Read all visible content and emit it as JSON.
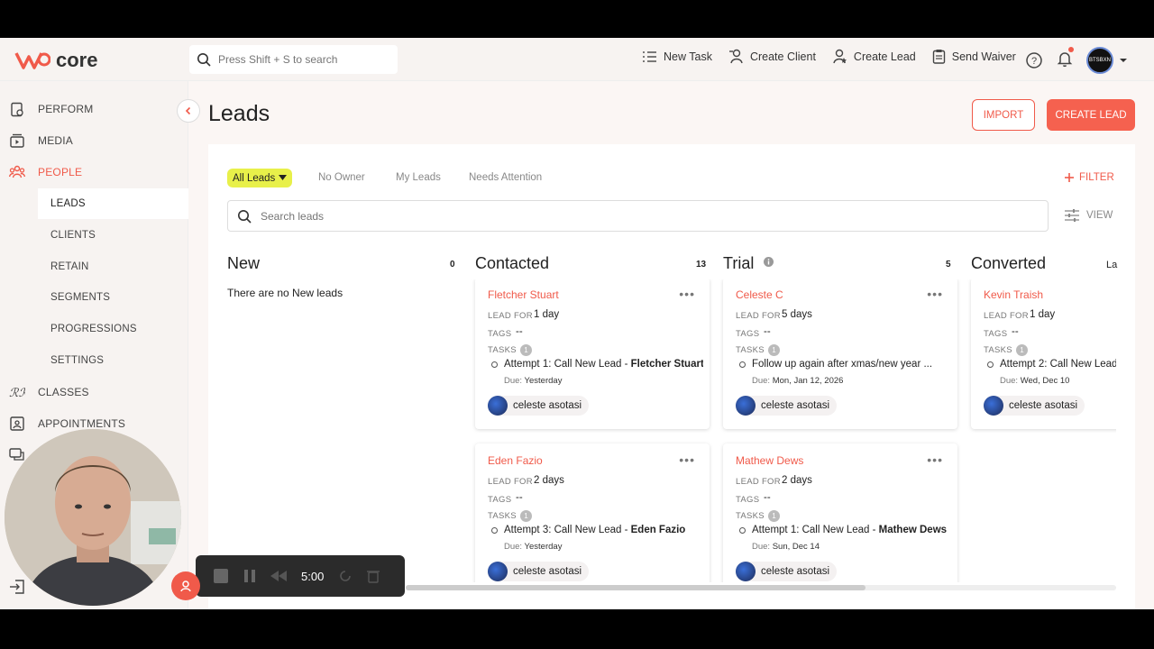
{
  "app": {
    "logo_text": "core"
  },
  "header": {
    "search_placeholder": "Press Shift + S to search",
    "actions": [
      {
        "label": "New Task",
        "icon": "tasks-icon"
      },
      {
        "label": "Create Client",
        "icon": "add-client-icon"
      },
      {
        "label": "Create Lead",
        "icon": "add-lead-icon"
      },
      {
        "label": "Send Waiver",
        "icon": "clipboard-icon"
      }
    ],
    "avatar_text": "BTSBXN"
  },
  "sidebar": {
    "items": [
      {
        "label": "PERFORM",
        "icon": "clipboard-check-icon"
      },
      {
        "label": "MEDIA",
        "icon": "media-icon"
      },
      {
        "label": "PEOPLE",
        "icon": "people-icon"
      },
      {
        "label": "CLASSES",
        "icon": "classes-icon"
      },
      {
        "label": "APPOINTMENTS",
        "icon": "appointments-icon"
      }
    ],
    "sub_items": [
      "LEADS",
      "CLIENTS",
      "RETAIN",
      "SEGMENTS",
      "PROGRESSIONS",
      "SETTINGS"
    ],
    "active_sub": "LEADS"
  },
  "main": {
    "title": "Leads",
    "import_label": "IMPORT",
    "create_label": "CREATE LEAD",
    "filters": {
      "active": "All Leads",
      "tabs": [
        "No Owner",
        "My Leads",
        "Needs Attention"
      ],
      "filter_label": "FILTER"
    },
    "search_placeholder": "Search leads",
    "view_label": "VIEW",
    "columns": [
      {
        "title": "New",
        "count": "0",
        "empty_text": "There are no New leads"
      },
      {
        "title": "Contacted",
        "count": "13"
      },
      {
        "title": "Trial",
        "count": "5"
      },
      {
        "title": "Converted",
        "count": "La"
      }
    ],
    "labels": {
      "lead_for": "LEAD FOR",
      "tags": "TAGS",
      "tasks": "TASKS",
      "due": "Due:"
    },
    "cards": [
      {
        "name": "Fletcher Stuart",
        "lead_for": "1 day",
        "tags": "--",
        "tasks_count": "1",
        "task_prefix": "Attempt 1: Call New Lead - ",
        "task_bold": "Fletcher Stuart",
        "due": "Yesterday",
        "owner": "celeste asotasi"
      },
      {
        "name": "Celeste C",
        "lead_for": "5 days",
        "tags": "--",
        "tasks_count": "1",
        "task_prefix": "Follow up again after xmas/new year ...",
        "task_bold": "",
        "due": "Mon, Jan 12, 2026",
        "owner": "celeste asotasi"
      },
      {
        "name": "Kevin Traish",
        "lead_for": "1 day",
        "tags": "--",
        "tasks_count": "1",
        "task_prefix": "Attempt 2: Call New Lead",
        "task_bold": "",
        "due": "Wed, Dec 10",
        "owner": "celeste asotasi"
      },
      {
        "name": "Eden Fazio",
        "lead_for": "2 days",
        "tags": "--",
        "tasks_count": "1",
        "task_prefix": "Attempt 3: Call New Lead - ",
        "task_bold": "Eden Fazio",
        "due": "Yesterday",
        "owner": "celeste asotasi"
      },
      {
        "name": "Mathew Dews",
        "lead_for": "2 days",
        "tags": "--",
        "tasks_count": "1",
        "task_prefix": "Attempt 1: Call New Lead - ",
        "task_bold": "Mathew Dews",
        "due": "Sun, Dec 14",
        "owner": "celeste asotasi"
      }
    ]
  },
  "recorder": {
    "time": "5:00"
  },
  "colors": {
    "accent": "#f05a4a",
    "active_filter": "#e8f04a"
  }
}
